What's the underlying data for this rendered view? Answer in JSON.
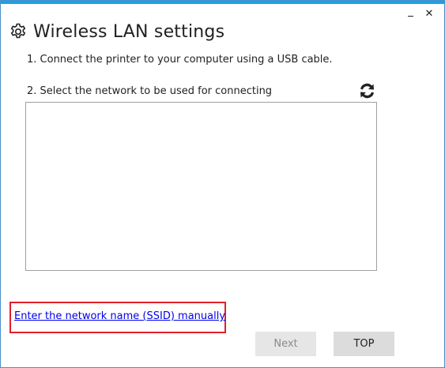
{
  "window": {
    "minimize_icon": "minimize-icon",
    "close_label": "✕",
    "accent_color": "#1ba1e2"
  },
  "header": {
    "icon": "gear-icon",
    "title": "Wireless LAN settings"
  },
  "steps": {
    "step1": "1. Connect the printer to your computer using a USB cable.",
    "step2": "2. Select the network to be used for connecting"
  },
  "network_list": {
    "items": [],
    "refresh_icon": "refresh-icon"
  },
  "manual_entry": {
    "link_text": "Enter the network name (SSID) manually",
    "highlight_color": "#e0202a"
  },
  "buttons": {
    "next": "Next",
    "top": "TOP"
  }
}
